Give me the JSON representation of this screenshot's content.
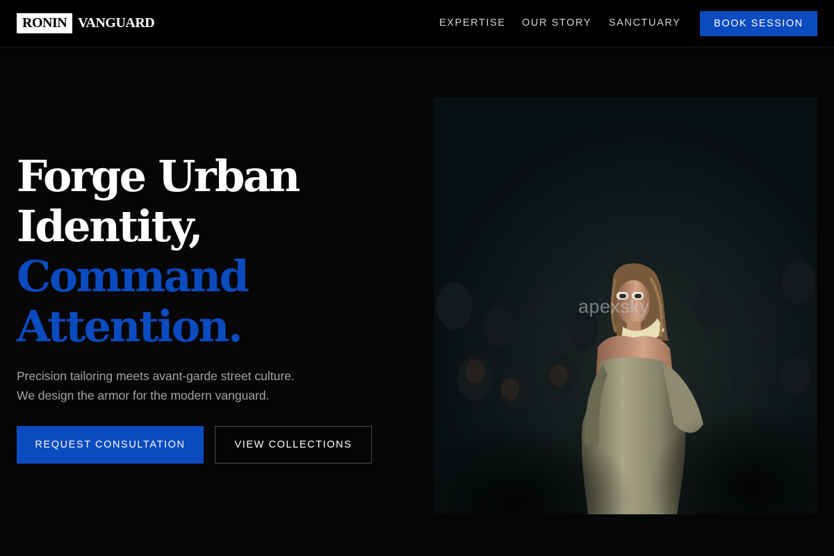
{
  "brand": {
    "box": "RONIN",
    "text": "VANGUARD"
  },
  "nav": {
    "links": [
      "EXPERTISE",
      "OUR STORY",
      "SANCTUARY"
    ],
    "cta": "BOOK SESSION"
  },
  "hero": {
    "title_lines": [
      "Forge Urban",
      "Identity,"
    ],
    "accent_lines": [
      "Command",
      "Attention."
    ],
    "subtitle_lines": [
      "Precision tailoring meets avant-garde street culture.",
      "We design the armor for the modern vanguard."
    ],
    "primary_button": "REQUEST CONSULTATION",
    "secondary_button": "VIEW COLLECTIONS"
  },
  "image": {
    "watermark": "apexsky"
  },
  "colors": {
    "accent": "#0a4bc0",
    "background": "#060606",
    "header": "#000000"
  }
}
